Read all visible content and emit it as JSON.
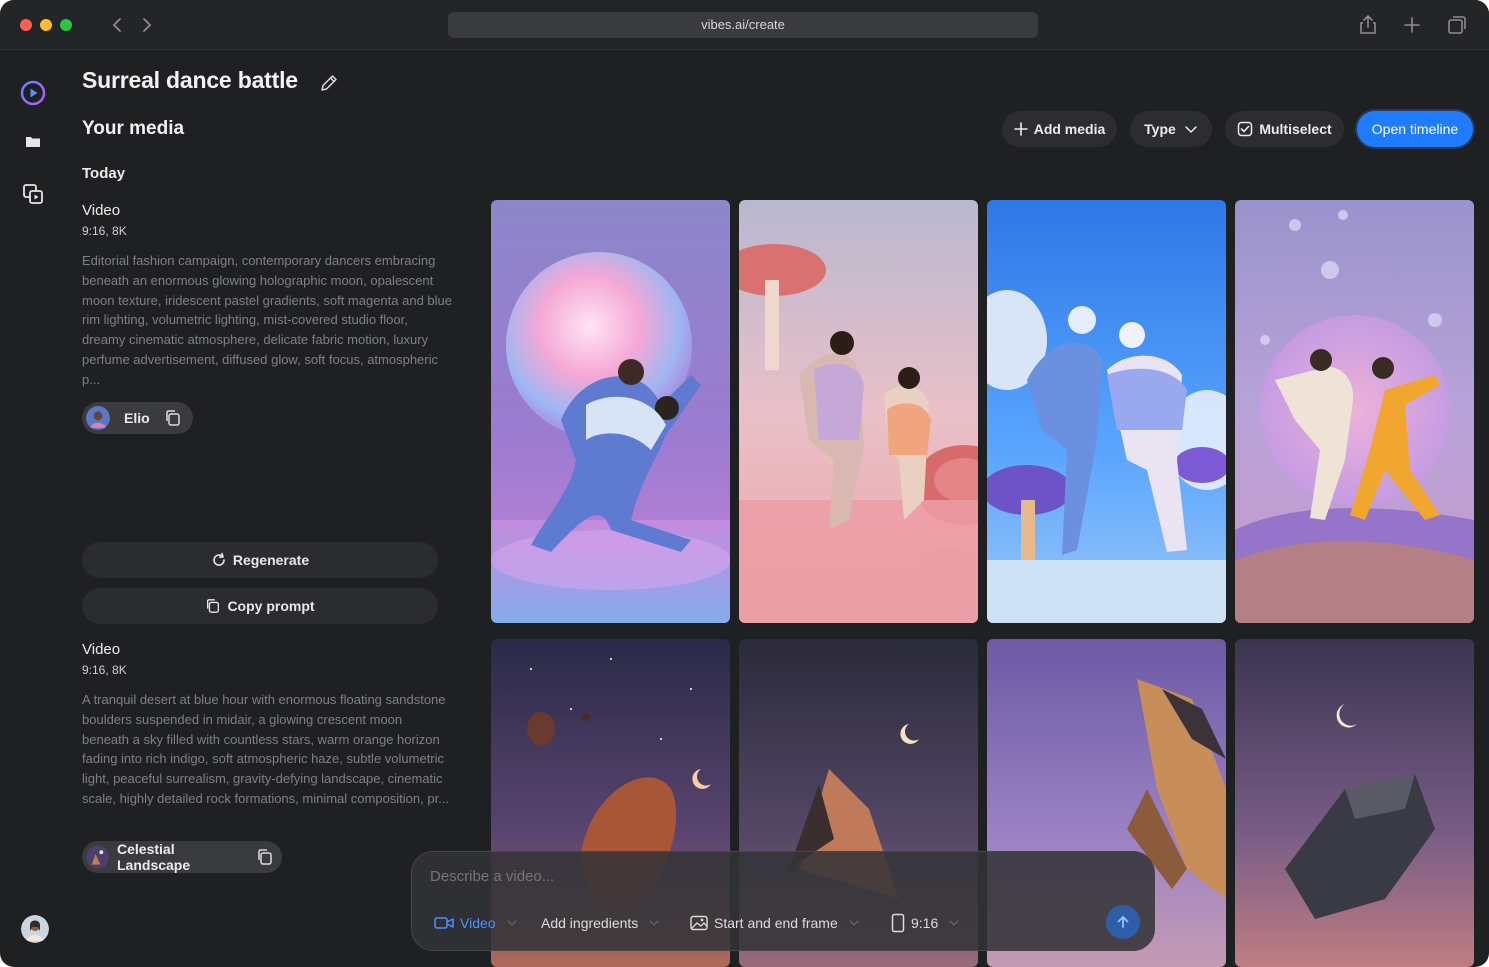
{
  "browser": {
    "url": "vibes.ai/create"
  },
  "project": {
    "title": "Surreal dance battle"
  },
  "media": {
    "section_title": "Your media",
    "day_label": "Today",
    "items": [
      {
        "type": "Video",
        "meta": "9:16, 8K",
        "prompt": "Editorial fashion campaign, contemporary dancers embracing beneath an enormous glowing holographic moon, opalescent moon texture, iridescent pastel gradients, soft magenta and blue rim lighting, volumetric lighting, mist-covered studio floor, dreamy cinematic atmosphere, delicate fabric motion, luxury perfume advertisement, diffused glow, soft focus, atmospheric p...",
        "chip_label": "Elio"
      },
      {
        "type": "Video",
        "meta": "9:16, 8K",
        "prompt": "A tranquil desert at blue hour with enormous floating sandstone boulders suspended in midair, a glowing crescent moon beneath a sky filled with countless stars, warm orange horizon fading into rich indigo, soft atmospheric haze, subtle volumetric light, peaceful surrealism, gravity-defying landscape, cinematic scale, highly detailed rock formations, minimal composition, pr...",
        "chip_label": "Celestial Landscape"
      }
    ]
  },
  "actions": {
    "regenerate": "Regenerate",
    "copy_prompt": "Copy prompt"
  },
  "toolbar": {
    "add_media": "Add media",
    "type": "Type",
    "multiselect": "Multiselect",
    "open_timeline": "Open timeline"
  },
  "composer": {
    "placeholder": "Describe a video...",
    "mode": "Video",
    "ingredients": "Add ingredients",
    "frames": "Start and end frame",
    "aspect": "9:16"
  },
  "colors": {
    "accent": "#1f7bff",
    "background": "#1f2022"
  }
}
